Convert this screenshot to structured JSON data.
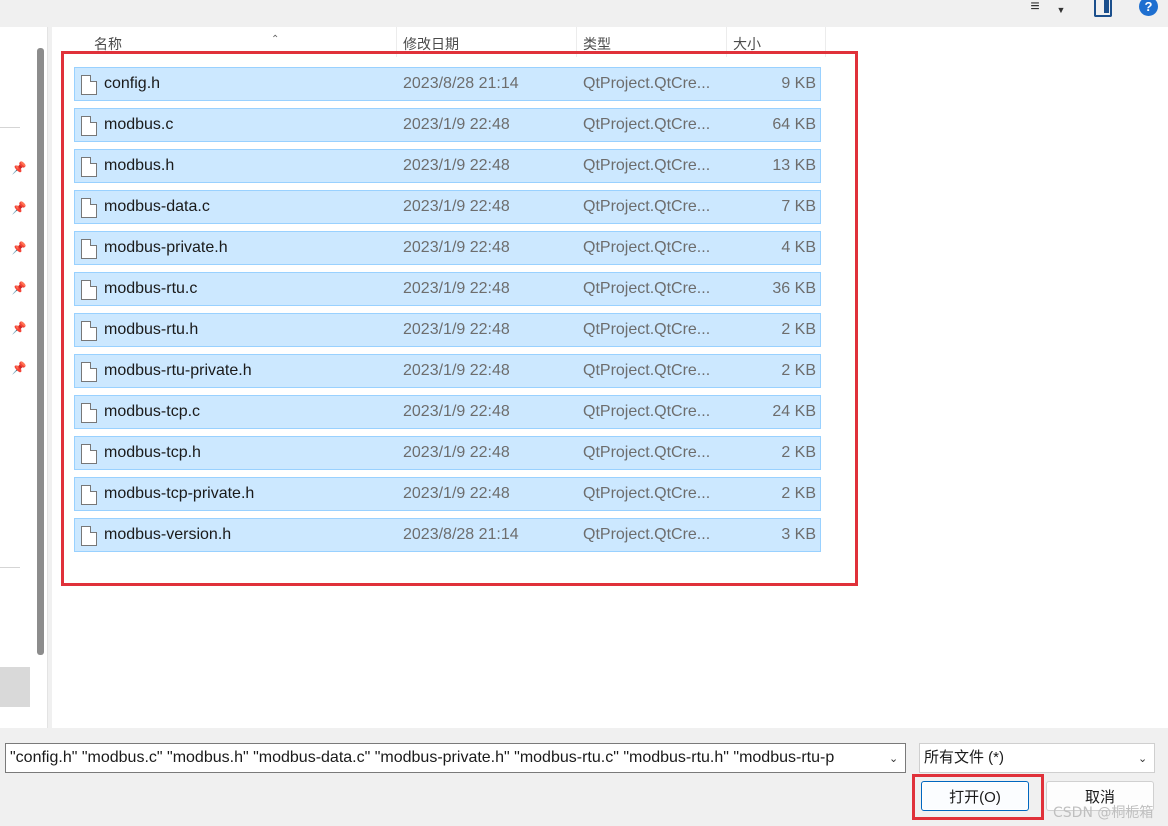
{
  "toolbar": {
    "view_icon": "list-view-icon",
    "view_dropdown_icon": "chevron-down-icon",
    "preview_pane_icon": "preview-pane-icon",
    "help_icon": "help-icon",
    "help_glyph": "?"
  },
  "columns": {
    "name": "名称",
    "date": "修改日期",
    "type": "类型",
    "size": "大小"
  },
  "files": [
    {
      "name": "config.h",
      "date": "2023/8/28 21:14",
      "type": "QtProject.QtCre...",
      "size": "9 KB"
    },
    {
      "name": "modbus.c",
      "date": "2023/1/9 22:48",
      "type": "QtProject.QtCre...",
      "size": "64 KB"
    },
    {
      "name": "modbus.h",
      "date": "2023/1/9 22:48",
      "type": "QtProject.QtCre...",
      "size": "13 KB"
    },
    {
      "name": "modbus-data.c",
      "date": "2023/1/9 22:48",
      "type": "QtProject.QtCre...",
      "size": "7 KB"
    },
    {
      "name": "modbus-private.h",
      "date": "2023/1/9 22:48",
      "type": "QtProject.QtCre...",
      "size": "4 KB"
    },
    {
      "name": "modbus-rtu.c",
      "date": "2023/1/9 22:48",
      "type": "QtProject.QtCre...",
      "size": "36 KB"
    },
    {
      "name": "modbus-rtu.h",
      "date": "2023/1/9 22:48",
      "type": "QtProject.QtCre...",
      "size": "2 KB"
    },
    {
      "name": "modbus-rtu-private.h",
      "date": "2023/1/9 22:48",
      "type": "QtProject.QtCre...",
      "size": "2 KB"
    },
    {
      "name": "modbus-tcp.c",
      "date": "2023/1/9 22:48",
      "type": "QtProject.QtCre...",
      "size": "24 KB"
    },
    {
      "name": "modbus-tcp.h",
      "date": "2023/1/9 22:48",
      "type": "QtProject.QtCre...",
      "size": "2 KB"
    },
    {
      "name": "modbus-tcp-private.h",
      "date": "2023/1/9 22:48",
      "type": "QtProject.QtCre...",
      "size": "2 KB"
    },
    {
      "name": "modbus-version.h",
      "date": "2023/8/28 21:14",
      "type": "QtProject.QtCre...",
      "size": "3 KB"
    }
  ],
  "footer": {
    "filename_value": "\"config.h\" \"modbus.c\" \"modbus.h\" \"modbus-data.c\" \"modbus-private.h\" \"modbus-rtu.c\" \"modbus-rtu.h\" \"modbus-rtu-p",
    "filetype_value": "所有文件 (*)",
    "open_label": "打开(O)",
    "cancel_label": "取消"
  },
  "watermark": "CSDN @桐栀箱",
  "colors": {
    "selection_fill": "#cce8ff",
    "selection_border": "#99d1ff",
    "annotation_red": "#e0313a",
    "primary_button_border": "#0067c0"
  }
}
